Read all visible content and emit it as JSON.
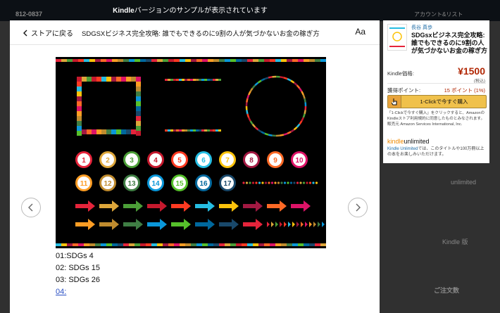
{
  "banner": {
    "brand": "Kindle",
    "text": "バージョンのサンプルが表示されています"
  },
  "background": {
    "zip": "812-0837",
    "right_top": "アカウント&リスト",
    "ku": "unlimited",
    "right_mid": "Kindle 版",
    "right_low": "ご注文数"
  },
  "reader": {
    "back_label": "ストアに戻る",
    "title": "SDGSXビジネス完全攻略: 誰でもできるのに9割の人が気づかないお金の稼ぎ方",
    "font_button": "Aa",
    "captions": [
      "01:SDGs 4",
      "02: SDGs 15",
      "03: SDGs 26",
      "04:"
    ]
  },
  "cover": {
    "numbers": [
      "1",
      "2",
      "3",
      "4",
      "5",
      "6",
      "7",
      "8",
      "9",
      "10",
      "11",
      "12",
      "13",
      "14",
      "15",
      "16",
      "17"
    ],
    "colors": [
      "#e5243b",
      "#dda63a",
      "#4c9f38",
      "#c5192d",
      "#ff3a21",
      "#26bde2",
      "#fcc30b",
      "#a21942",
      "#fd6925",
      "#dd1367",
      "#fd9d24",
      "#bf8b2e",
      "#3f7e44",
      "#0a97d9",
      "#56c02b",
      "#00689d",
      "#19486a"
    ]
  },
  "card": {
    "author": "長谷 真歩",
    "title": "SDGsxビジネス完全攻略: 誰でもできるのに9割の人が気づかないお金の稼ぎ方",
    "price_label": "Kindle価格:",
    "price": "¥1500",
    "tax": "(税込)",
    "points_label": "獲得ポイント:",
    "points": "15 ポイント (1%)",
    "buy_label": "1-Clickで今すぐ購入",
    "fine_print": "「1-Clickで今すぐ購入」をクリックすると、AmazonのKindleストア利用規約に同意したものとみなされます。販売元 Amazon Services International, Inc.",
    "ku_brand_k": "kindle",
    "ku_brand_u": "unlimited",
    "ku_link": "Kindle Unlimited",
    "ku_text": "では、このタイトルや100万冊以上の本をお楽しみいただけます。"
  }
}
